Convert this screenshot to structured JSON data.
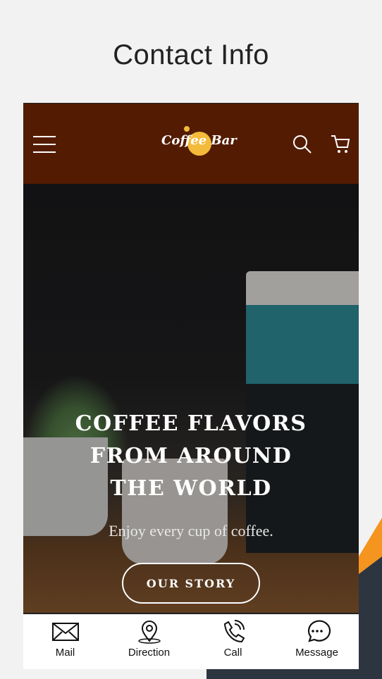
{
  "page_title": "Contact Info",
  "app": {
    "logo_text": "Coffee Bar",
    "brand_color": "#531c02",
    "accent": "#f4bb3a"
  },
  "hero": {
    "title_lines": [
      "COFFEE FLAVORS",
      "FROM AROUND",
      "THE WORLD"
    ],
    "subtitle": "Enjoy every cup of coffee.",
    "button": "OUR STORY"
  },
  "bottom_nav": [
    {
      "label": "Mail",
      "icon": "envelope-icon"
    },
    {
      "label": "Direction",
      "icon": "location-pin-icon"
    },
    {
      "label": "Call",
      "icon": "phone-icon"
    },
    {
      "label": "Message",
      "icon": "chat-bubble-icon"
    }
  ]
}
